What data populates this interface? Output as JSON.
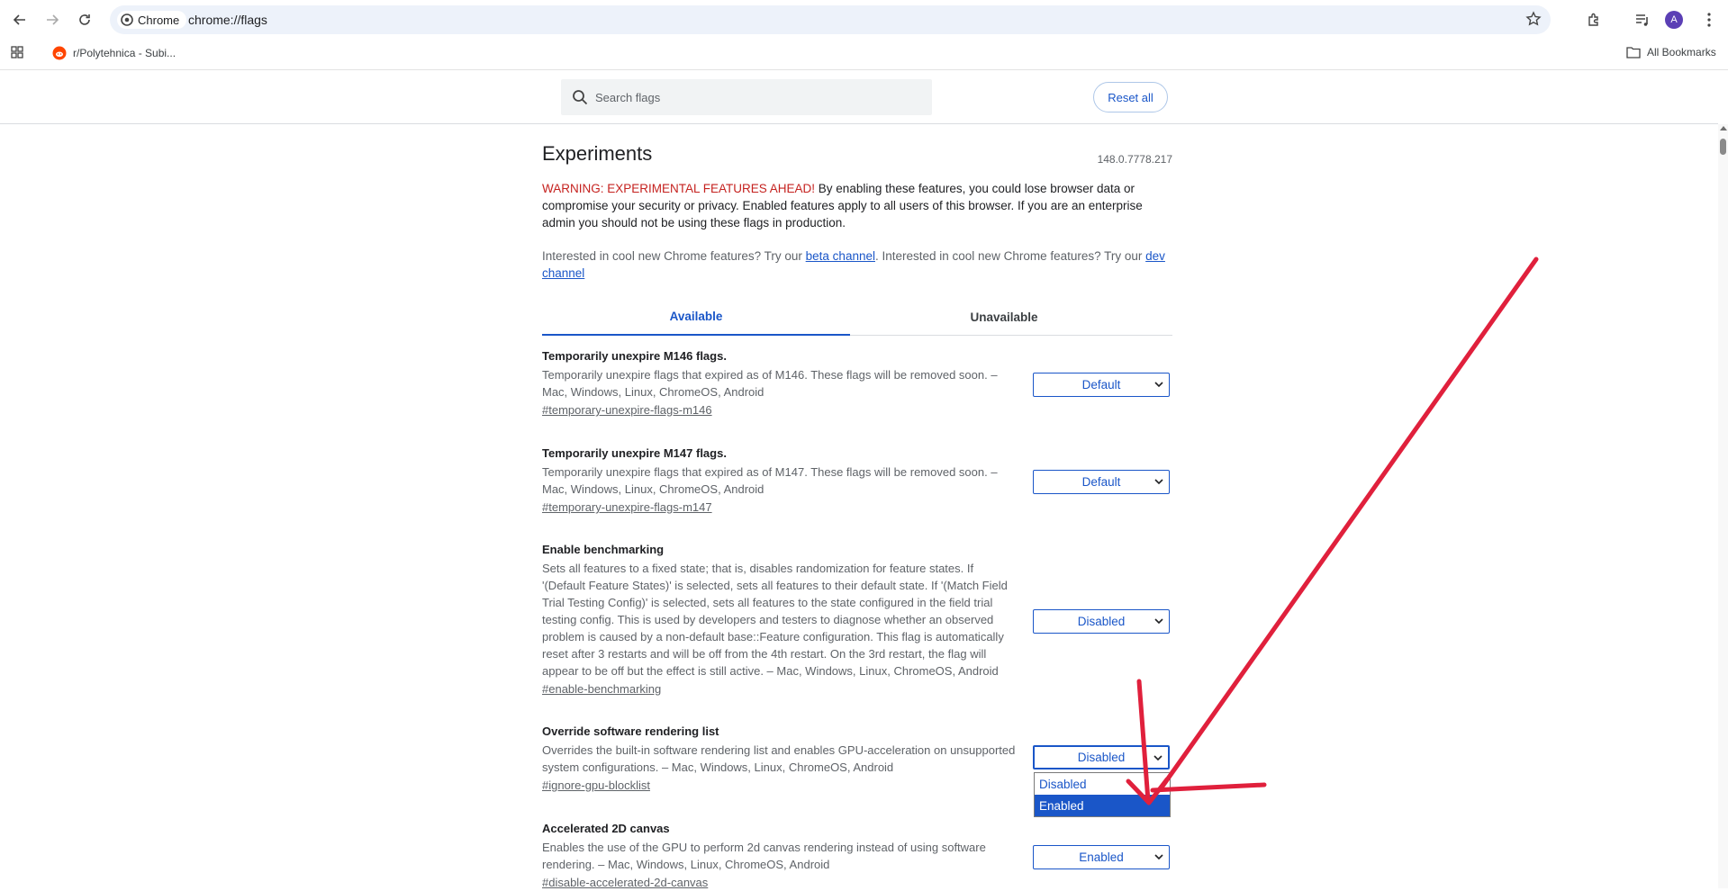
{
  "browser": {
    "chip_label": "Chrome",
    "url": "chrome://flags",
    "avatar_letter": "A",
    "bookmarks": [
      {
        "label": "r/Polytehnica - Subi..."
      }
    ],
    "all_bookmarks_label": "All Bookmarks"
  },
  "header": {
    "search_placeholder": "Search flags",
    "reset_label": "Reset all"
  },
  "page": {
    "title": "Experiments",
    "version": "148.0.7778.217",
    "warning_red": "WARNING: EXPERIMENTAL FEATURES AHEAD!",
    "warning_text": " By enabling these features, you could lose browser data or compromise your security or privacy. Enabled features apply to all users of this browser. If you are an enterprise admin you should not be using these flags in production.",
    "interest_1": "Interested in cool new Chrome features? Try our ",
    "beta_link": "beta channel",
    "interest_2": ". Interested in cool new Chrome features? Try our ",
    "dev_link": "dev channel",
    "tabs": [
      {
        "label": "Available"
      },
      {
        "label": "Unavailable"
      }
    ]
  },
  "flags": [
    {
      "name": "Temporarily unexpire M146 flags.",
      "desc": "Temporarily unexpire flags that expired as of M146. These flags will be removed soon. – Mac, Windows, Linux, ChromeOS, Android",
      "link": "#temporary-unexpire-flags-m146",
      "value": "Default"
    },
    {
      "name": "Temporarily unexpire M147 flags.",
      "desc": "Temporarily unexpire flags that expired as of M147. These flags will be removed soon. – Mac, Windows, Linux, ChromeOS, Android",
      "link": "#temporary-unexpire-flags-m147",
      "value": "Default"
    },
    {
      "name": "Enable benchmarking",
      "desc": "Sets all features to a fixed state; that is, disables randomization for feature states. If '(Default Feature States)' is selected, sets all features to their default state. If '(Match Field Trial Testing Config)' is selected, sets all features to the state configured in the field trial testing config. This is used by developers and testers to diagnose whether an observed problem is caused by a non-default base::Feature configuration. This flag is automatically reset after 3 restarts and will be off from the 4th restart. On the 3rd restart, the flag will appear to be off but the effect is still active. – Mac, Windows, Linux, ChromeOS, Android",
      "link": "#enable-benchmarking",
      "value": "Disabled"
    },
    {
      "name": "Override software rendering list",
      "desc": "Overrides the built-in software rendering list and enables GPU-acceleration on unsupported system configurations. – Mac, Windows, Linux, ChromeOS, Android",
      "link": "#ignore-gpu-blocklist",
      "value": "Disabled"
    },
    {
      "name": "Accelerated 2D canvas",
      "desc": "Enables the use of the GPU to perform 2d canvas rendering instead of using software rendering. – Mac, Windows, Linux, ChromeOS, Android",
      "link": "#disable-accelerated-2d-canvas",
      "value": "Enabled"
    }
  ],
  "dropdown": {
    "options": [
      {
        "label": "Disabled"
      },
      {
        "label": "Enabled"
      }
    ]
  },
  "annotation": {
    "color": "#e0203c"
  }
}
